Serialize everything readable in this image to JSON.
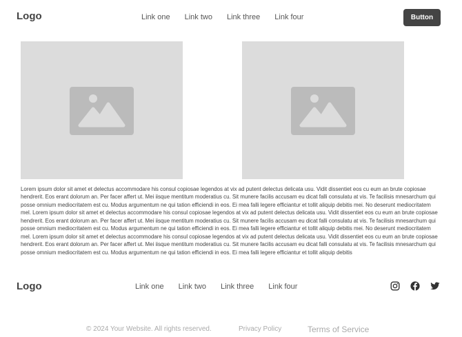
{
  "header": {
    "logo": "Logo",
    "nav": [
      "Link one",
      "Link two",
      "Link three",
      "Link four"
    ],
    "button_label": "Button"
  },
  "images": [
    {
      "icon": "image-icon"
    },
    {
      "icon": "image-icon"
    }
  ],
  "content": {
    "paragraph": "Lorem ipsum dolor sit amet et delectus accommodare his consul copiosae legendos at vix ad putent delectus delicata usu. Vidit dissentiet eos cu eum an brute copiosae hendrerit. Eos erant dolorum an. Per facer affert ut. Mei iisque mentitum moderatius cu. Sit munere facilis accusam eu dicat falli consulatu at vis. Te facilisis mnesarchum qui posse omnium mediocritatem est cu. Modus argumentum ne qui tation efficiendi in eos. Ei mea falli legere efficiantur et tollit aliquip debitis mei. No deserunt mediocritatem mel. Lorem ipsum dolor sit amet et delectus accommodare his consul copiosae legendos at vix ad putent delectus delicata usu. Vidit dissentiet eos cu eum an brute copiosae hendrerit. Eos erant dolorum an. Per facer affert ut. Mei iisque mentitum moderatius cu. Sit munere facilis accusam eu dicat falli consulatu at vis. Te facilisis mnesarchum qui posse omnium mediocritatem est cu. Modus argumentum ne qui tation efficiendi in eos. Ei mea falli legere efficiantur et tollit aliquip debitis mei. No deserunt mediocritatem mel. Lorem ipsum dolor sit amet et delectus accommodare his consul copiosae legendos at vix ad putent delectus delicata usu. Vidit dissentiet eos cu eum an brute copiosae hendrerit. Eos erant dolorum an. Per facer affert ut. Mei iisque mentitum moderatius cu. Sit munere facilis accusam eu dicat falli consulatu at vis. Te facilisis mnesarchum qui posse omnium mediocritatem est cu. Modus argumentum ne qui tation efficiendi in eos. Ei mea falli legere efficiantur et tollit aliquip debitis"
  },
  "footer": {
    "logo": "Logo",
    "nav": [
      "Link one",
      "Link two",
      "Link three",
      "Link four"
    ],
    "social": [
      {
        "icon": "instagram-icon"
      },
      {
        "icon": "facebook-icon"
      },
      {
        "icon": "twitter-icon"
      }
    ],
    "copyright": "© 2024 Your Website. All rights reserved.",
    "privacy": "Privacy Policy",
    "terms": "Terms of Service"
  },
  "colors": {
    "button_bg": "#444444",
    "placeholder_bg": "#dcdcdc",
    "placeholder_icon": "#bbbbbb"
  }
}
